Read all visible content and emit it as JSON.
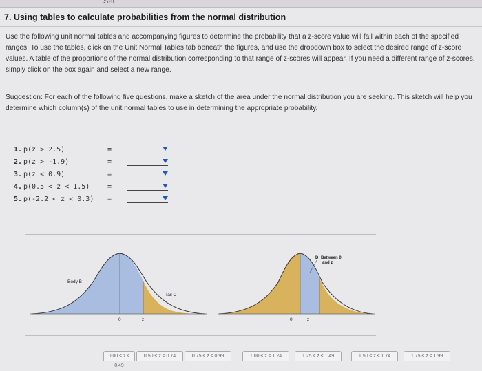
{
  "header": {
    "partial_title": "Set",
    "title": "7. Using tables to calculate probabilities from the normal distribution"
  },
  "instructions": "Use the following unit normal tables and accompanying figures to determine the probability that a z-score value will fall within each of the specified ranges. To use the tables, click on the Unit Normal Tables tab beneath the figures, and use the dropdown box to select the desired range of z-score values. A table of the proportions of the normal distribution corresponding to that range of z-scores will appear. If you need a different range of z-scores, simply click on the box again and select a new range.",
  "suggestion": "Suggestion: For each of the following five questions, make a sketch of the area under the normal distribution you are seeking. This sketch will help you determine which column(s) of the unit normal tables to use in determining the appropriate probability.",
  "questions": [
    {
      "num": "1.",
      "text": "p(z > 2.5)",
      "eq": "="
    },
    {
      "num": "2.",
      "text": "p(z > -1.9)",
      "eq": "="
    },
    {
      "num": "3.",
      "text": "p(z < 0.9)",
      "eq": "="
    },
    {
      "num": "4.",
      "text": "p(0.5 < z < 1.5)",
      "eq": "="
    },
    {
      "num": "5.",
      "text": "p(-2.2 < z < 0.3)",
      "eq": "="
    }
  ],
  "figures": {
    "body_label": "Body B",
    "tail_label": "Tail C",
    "between_label_1": "D: Between 0",
    "between_label_2": "and z",
    "zero": "0",
    "z": "z"
  },
  "tabs": [
    "0.00 ≤ z ≤ 0.49",
    "0.50 ≤ z ≤ 0.74",
    "0.75 ≤ z ≤ 0.99",
    "1.00 ≤ z ≤ 1.24",
    "1.25 ≤ z ≤ 1.49",
    "1.50 ≤ z ≤ 1.74",
    "1.75 ≤ z ≤ 1.99"
  ],
  "colors": {
    "body_fill": "#a9bde0",
    "tail_fill": "#d8b25c",
    "curve": "#333333",
    "dropdown_caret": "#1f5bb5"
  }
}
